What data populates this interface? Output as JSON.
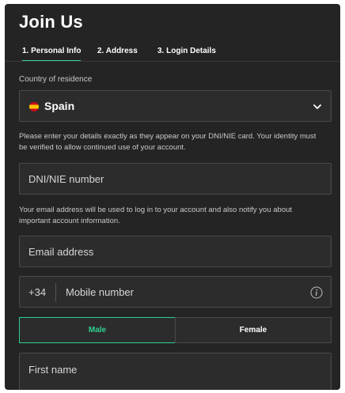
{
  "page": {
    "title": "Join Us"
  },
  "tabs": [
    {
      "label": "1. Personal Info",
      "active": true
    },
    {
      "label": "2. Address",
      "active": false
    },
    {
      "label": "3. Login Details",
      "active": false
    }
  ],
  "country": {
    "label": "Country of residence",
    "value": "Spain",
    "flag_icon": "spain-flag-icon"
  },
  "identity": {
    "helper": "Please enter your details exactly as they appear on your DNI/NIE card. Your identity must be verified to allow continued use of your account.",
    "dni_placeholder": "DNI/NIE number"
  },
  "email": {
    "helper": "Your email address will be used to log in to your account and also notify you about important account information.",
    "placeholder": "Email address"
  },
  "mobile": {
    "prefix": "+34",
    "placeholder": "Mobile number"
  },
  "gender": {
    "options": [
      "Male",
      "Female"
    ],
    "selected": "Male"
  },
  "first_name": {
    "placeholder": "First name"
  },
  "colors": {
    "accent": "#2fd18f",
    "background": "#242424",
    "field": "#2c2c2c"
  }
}
